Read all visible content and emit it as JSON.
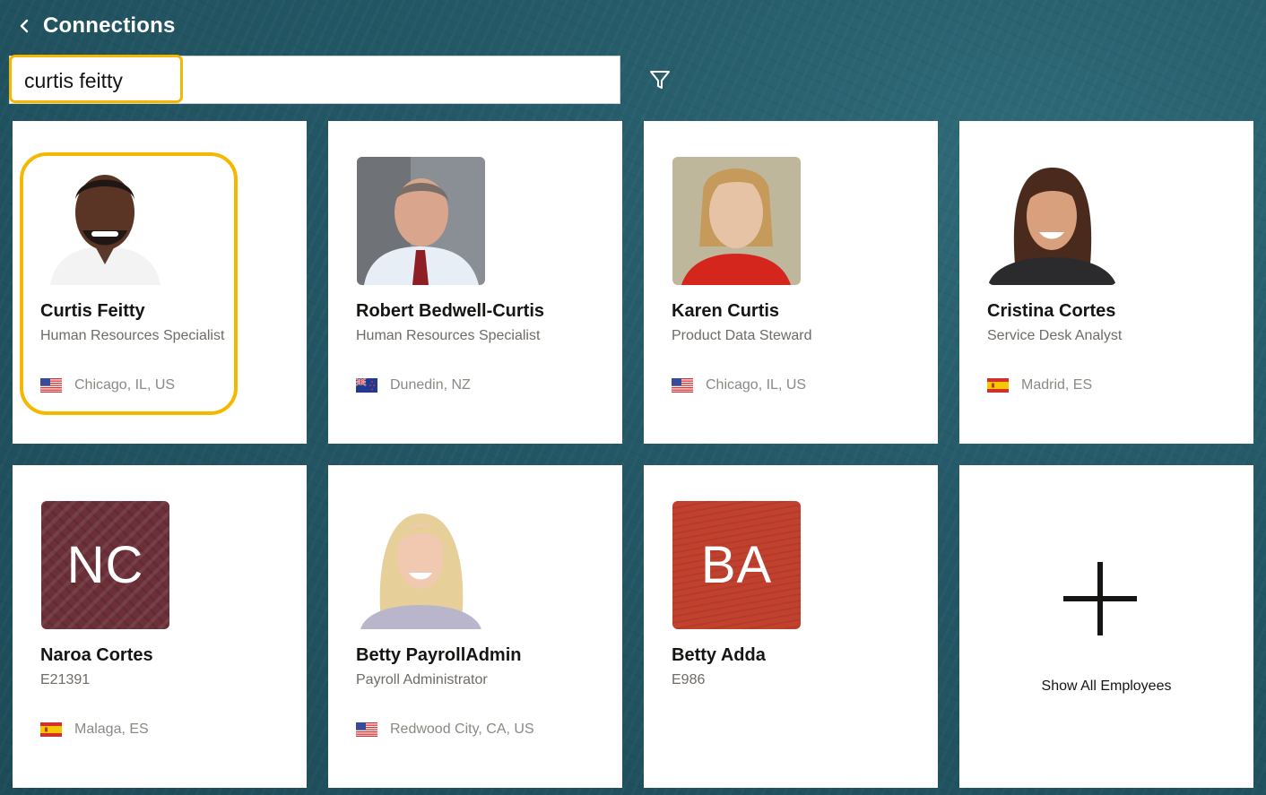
{
  "header": {
    "title": "Connections",
    "back_icon": "chevron-left-icon"
  },
  "search": {
    "value": "curtis feitty",
    "placeholder": "",
    "filter_icon": "filter-icon"
  },
  "cards": [
    {
      "name": "Curtis Feitty",
      "role": "Human Resources Specialist",
      "location": "Chicago, IL, US",
      "flag": "US"
    },
    {
      "name": "Robert Bedwell-Curtis",
      "role": "Human Resources Specialist",
      "location": "Dunedin, NZ",
      "flag": "NZ"
    },
    {
      "name": "Karen Curtis",
      "role": "Product Data Steward",
      "location": "Chicago, IL, US",
      "flag": "US"
    },
    {
      "name": "Cristina Cortes",
      "role": "Service Desk Analyst",
      "location": "Madrid, ES",
      "flag": "ES"
    },
    {
      "name": "Naroa Cortes",
      "role": "E21391",
      "location": "Malaga, ES",
      "flag": "ES",
      "initials": "NC"
    },
    {
      "name": "Betty PayrollAdmin",
      "role": "Payroll Administrator",
      "location": "Redwood City, CA, US",
      "flag": "US"
    },
    {
      "name": "Betty Adda",
      "role": "E986",
      "location": "",
      "flag": "",
      "initials": "BA"
    }
  ],
  "show_all": {
    "label": "Show All Employees",
    "icon": "plus-icon"
  },
  "colors": {
    "highlight": "#f5b800",
    "background": "#245866",
    "nc_tile": "#6b3038",
    "ba_tile": "#c2402e"
  }
}
